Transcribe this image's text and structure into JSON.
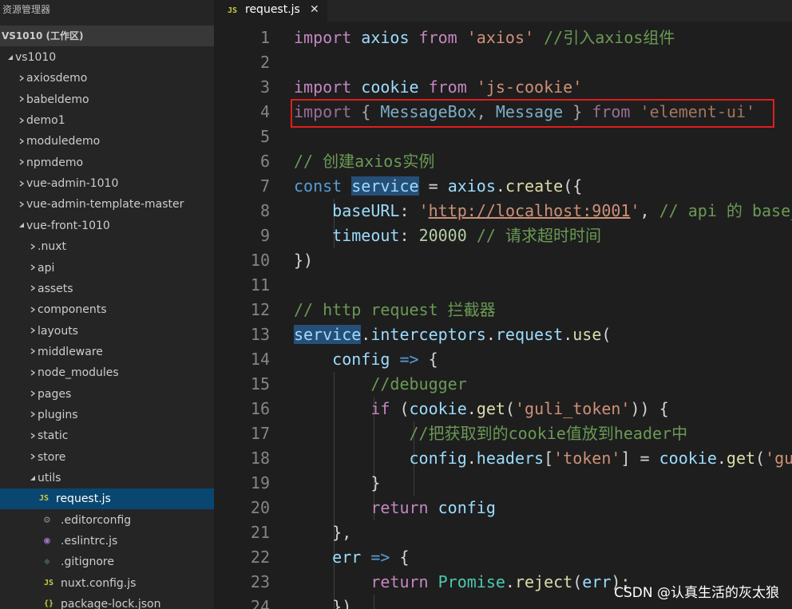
{
  "explorer": {
    "title": "资源管理器",
    "workspace": "VS1010 (工作区)",
    "tree": [
      {
        "label": "vs1010",
        "depth": 0,
        "kind": "folder",
        "open": true
      },
      {
        "label": "axiosdemo",
        "depth": 1,
        "kind": "folder",
        "open": false
      },
      {
        "label": "babeldemo",
        "depth": 1,
        "kind": "folder",
        "open": false
      },
      {
        "label": "demo1",
        "depth": 1,
        "kind": "folder",
        "open": false
      },
      {
        "label": "moduledemo",
        "depth": 1,
        "kind": "folder",
        "open": false
      },
      {
        "label": "npmdemo",
        "depth": 1,
        "kind": "folder",
        "open": false
      },
      {
        "label": "vue-admin-1010",
        "depth": 1,
        "kind": "folder",
        "open": false
      },
      {
        "label": "vue-admin-template-master",
        "depth": 1,
        "kind": "folder",
        "open": false
      },
      {
        "label": "vue-front-1010",
        "depth": 1,
        "kind": "folder",
        "open": true
      },
      {
        "label": ".nuxt",
        "depth": 2,
        "kind": "folder",
        "open": false
      },
      {
        "label": "api",
        "depth": 2,
        "kind": "folder",
        "open": false
      },
      {
        "label": "assets",
        "depth": 2,
        "kind": "folder",
        "open": false
      },
      {
        "label": "components",
        "depth": 2,
        "kind": "folder",
        "open": false
      },
      {
        "label": "layouts",
        "depth": 2,
        "kind": "folder",
        "open": false
      },
      {
        "label": "middleware",
        "depth": 2,
        "kind": "folder",
        "open": false
      },
      {
        "label": "node_modules",
        "depth": 2,
        "kind": "folder",
        "open": false
      },
      {
        "label": "pages",
        "depth": 2,
        "kind": "folder",
        "open": false
      },
      {
        "label": "plugins",
        "depth": 2,
        "kind": "folder",
        "open": false
      },
      {
        "label": "static",
        "depth": 2,
        "kind": "folder",
        "open": false
      },
      {
        "label": "store",
        "depth": 2,
        "kind": "folder",
        "open": false
      },
      {
        "label": "utils",
        "depth": 2,
        "kind": "folder",
        "open": true
      },
      {
        "label": "request.js",
        "depth": 3,
        "kind": "js",
        "selected": true
      },
      {
        "label": ".editorconfig",
        "depth": 2,
        "kind": "gear"
      },
      {
        "label": ".eslintrc.js",
        "depth": 2,
        "kind": "eslint"
      },
      {
        "label": ".gitignore",
        "depth": 2,
        "kind": "git"
      },
      {
        "label": "nuxt.config.js",
        "depth": 2,
        "kind": "js"
      },
      {
        "label": "package-lock.json",
        "depth": 2,
        "kind": "json"
      }
    ],
    "icons": {
      "js": "JS",
      "json": "{}",
      "gear": "⚙",
      "eslint": "◉",
      "git": "◆"
    }
  },
  "tab": {
    "icon": "JS",
    "name": "request.js",
    "close": "✕"
  },
  "editor": {
    "lines": [
      {
        "n": "1",
        "tokens": [
          [
            "k",
            "import"
          ],
          [
            "v",
            " axios "
          ],
          [
            "k",
            "from"
          ],
          [
            "p",
            " "
          ],
          [
            "s",
            "'axios'"
          ],
          [
            "p",
            " "
          ],
          [
            "c",
            "//引入axios组件"
          ]
        ]
      },
      {
        "n": "2",
        "tokens": []
      },
      {
        "n": "3",
        "tokens": [
          [
            "k",
            "import"
          ],
          [
            "v",
            " cookie "
          ],
          [
            "k",
            "from"
          ],
          [
            "p",
            " "
          ],
          [
            "s",
            "'js-cookie'"
          ]
        ]
      },
      {
        "n": "4",
        "dim": true,
        "tokens": [
          [
            "k",
            "import"
          ],
          [
            "p",
            " { "
          ],
          [
            "v",
            "MessageBox"
          ],
          [
            "p",
            ", "
          ],
          [
            "v",
            "Message"
          ],
          [
            "p",
            " } "
          ],
          [
            "k",
            "from"
          ],
          [
            "p",
            " "
          ],
          [
            "s",
            "'element-ui'"
          ]
        ]
      },
      {
        "n": "5",
        "tokens": []
      },
      {
        "n": "6",
        "tokens": [
          [
            "c",
            "// 创建axios实例"
          ]
        ]
      },
      {
        "n": "7",
        "tokens": [
          [
            "kb",
            "const"
          ],
          [
            "p",
            " "
          ],
          [
            "vh",
            "service"
          ],
          [
            "p",
            " = "
          ],
          [
            "v",
            "axios"
          ],
          [
            "p",
            "."
          ],
          [
            "f",
            "create"
          ],
          [
            "p",
            "({"
          ]
        ]
      },
      {
        "n": "8",
        "tokens": [
          [
            "p",
            "    "
          ],
          [
            "v",
            "baseURL"
          ],
          [
            "p",
            ": "
          ],
          [
            "s",
            "'"
          ],
          [
            "u",
            "http://localhost:9001"
          ],
          [
            "s",
            "'"
          ],
          [
            "p",
            ", "
          ],
          [
            "c",
            "// api 的 base_url"
          ]
        ]
      },
      {
        "n": "9",
        "tokens": [
          [
            "p",
            "    "
          ],
          [
            "v",
            "timeout"
          ],
          [
            "p",
            ": "
          ],
          [
            "n",
            "20000"
          ],
          [
            "p",
            " "
          ],
          [
            "c",
            "// 请求超时时间"
          ]
        ]
      },
      {
        "n": "10",
        "tokens": [
          [
            "p",
            "})"
          ]
        ]
      },
      {
        "n": "11",
        "tokens": []
      },
      {
        "n": "12",
        "tokens": [
          [
            "c",
            "// http request 拦截器"
          ]
        ]
      },
      {
        "n": "13",
        "tokens": [
          [
            "vh",
            "service"
          ],
          [
            "p",
            "."
          ],
          [
            "v",
            "interceptors"
          ],
          [
            "p",
            "."
          ],
          [
            "v",
            "request"
          ],
          [
            "p",
            "."
          ],
          [
            "f",
            "use"
          ],
          [
            "p",
            "("
          ]
        ]
      },
      {
        "n": "14",
        "tokens": [
          [
            "p",
            "    "
          ],
          [
            "v",
            "config"
          ],
          [
            "p",
            " "
          ],
          [
            "kb",
            "=>"
          ],
          [
            "p",
            " {"
          ]
        ]
      },
      {
        "n": "15",
        "tokens": [
          [
            "p",
            "        "
          ],
          [
            "c",
            "//debugger"
          ]
        ]
      },
      {
        "n": "16",
        "tokens": [
          [
            "p",
            "        "
          ],
          [
            "k",
            "if"
          ],
          [
            "p",
            " ("
          ],
          [
            "v",
            "cookie"
          ],
          [
            "p",
            "."
          ],
          [
            "f",
            "get"
          ],
          [
            "p",
            "("
          ],
          [
            "s",
            "'guli_token'"
          ],
          [
            "p",
            ")) {"
          ]
        ]
      },
      {
        "n": "17",
        "tokens": [
          [
            "p",
            "            "
          ],
          [
            "c",
            "//把获取到的cookie值放到header中"
          ]
        ]
      },
      {
        "n": "18",
        "tokens": [
          [
            "p",
            "            "
          ],
          [
            "v",
            "config"
          ],
          [
            "p",
            "."
          ],
          [
            "v",
            "headers"
          ],
          [
            "p",
            "["
          ],
          [
            "s",
            "'token'"
          ],
          [
            "p",
            "] = "
          ],
          [
            "v",
            "cookie"
          ],
          [
            "p",
            "."
          ],
          [
            "f",
            "get"
          ],
          [
            "p",
            "("
          ],
          [
            "s",
            "'guli_token'"
          ],
          [
            "p",
            ")"
          ]
        ]
      },
      {
        "n": "19",
        "tokens": [
          [
            "p",
            "        }"
          ]
        ]
      },
      {
        "n": "20",
        "tokens": [
          [
            "p",
            "        "
          ],
          [
            "k",
            "return"
          ],
          [
            "p",
            " "
          ],
          [
            "v",
            "config"
          ]
        ]
      },
      {
        "n": "21",
        "tokens": [
          [
            "p",
            "    },"
          ]
        ]
      },
      {
        "n": "22",
        "tokens": [
          [
            "p",
            "    "
          ],
          [
            "v",
            "err"
          ],
          [
            "p",
            " "
          ],
          [
            "kb",
            "=>"
          ],
          [
            "p",
            " {"
          ]
        ]
      },
      {
        "n": "23",
        "tokens": [
          [
            "p",
            "        "
          ],
          [
            "k",
            "return"
          ],
          [
            "p",
            " "
          ],
          [
            "t",
            "Promise"
          ],
          [
            "p",
            "."
          ],
          [
            "f",
            "reject"
          ],
          [
            "p",
            "("
          ],
          [
            "v",
            "err"
          ],
          [
            "p",
            ");"
          ]
        ]
      },
      {
        "n": "24",
        "tokens": [
          [
            "p",
            "    })"
          ]
        ]
      }
    ]
  },
  "watermark": "CSDN @认真生活的灰太狼",
  "colors": {
    "background": "#1e1e1e",
    "sidebar": "#252526",
    "selection": "#094771",
    "highlight_box": "#e01e1e",
    "keyword": "#c586c0",
    "string": "#ce9178",
    "comment": "#6a9955",
    "variable": "#9cdcfe"
  }
}
